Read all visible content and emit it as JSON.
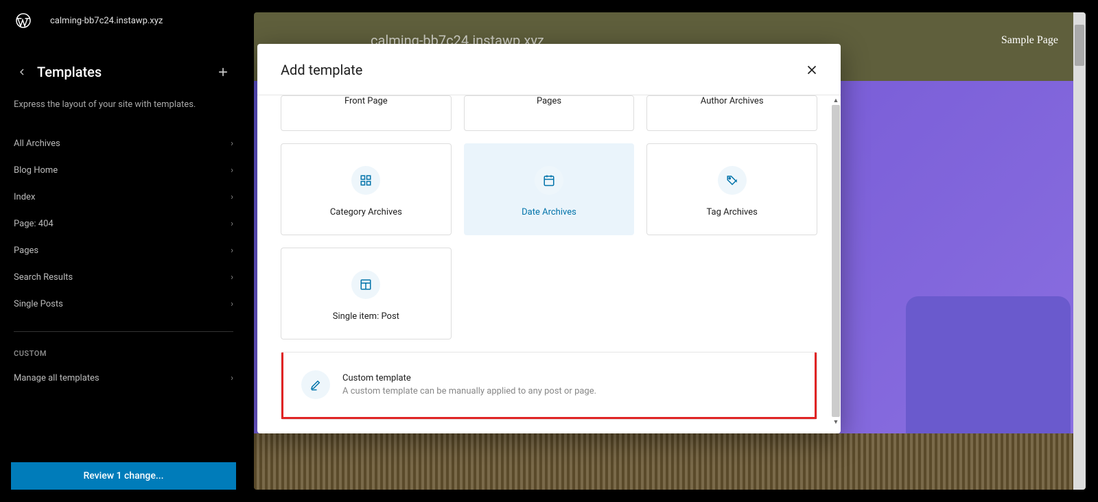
{
  "topbar": {
    "site_name": "calming-bb7c24.instawp.xyz"
  },
  "sidebar": {
    "title": "Templates",
    "description": "Express the layout of your site with templates.",
    "items": [
      {
        "label": "All Archives"
      },
      {
        "label": "Blog Home"
      },
      {
        "label": "Index"
      },
      {
        "label": "Page: 404"
      },
      {
        "label": "Pages"
      },
      {
        "label": "Search Results"
      },
      {
        "label": "Single Posts"
      }
    ],
    "custom_label": "CUSTOM",
    "manage_label": "Manage all templates",
    "review_label": "Review 1 change..."
  },
  "canvas": {
    "site_title": "calming-bb7c24.instawp.xyz",
    "nav_item": "Sample Page"
  },
  "modal": {
    "title": "Add template",
    "top_row": [
      {
        "label": "Front Page"
      },
      {
        "label": "Pages"
      },
      {
        "label": "Author Archives"
      }
    ],
    "cards": [
      {
        "label": "Category Archives",
        "icon": "grid"
      },
      {
        "label": "Date Archives",
        "icon": "calendar",
        "active": true
      },
      {
        "label": "Tag Archives",
        "icon": "tag"
      },
      {
        "label": "Single item: Post",
        "icon": "layout"
      }
    ],
    "custom": {
      "title": "Custom template",
      "description": "A custom template can be manually applied to any post or page."
    }
  }
}
